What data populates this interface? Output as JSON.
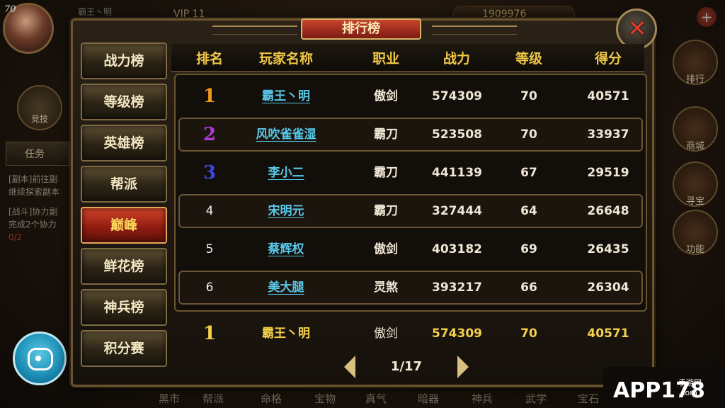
{
  "hud": {
    "level": "70",
    "player_name": "霸王丶明",
    "vip": "VIP 11",
    "gold": "1909976",
    "plus": "+",
    "task_label": "任务",
    "quest_line_1": "[副本]前往副",
    "quest_line_2": "继续探索副本",
    "quest_line_3": "[战斗]协力副",
    "quest_line_4": "完成2个协力",
    "quest_line_5": "0/2",
    "arena_label": "竞技",
    "right_icons": [
      "排行",
      "商城",
      "寻宝",
      "功能"
    ],
    "bottom_bar": [
      "黑市",
      "帮派",
      "命格",
      "宝物",
      "真气",
      "暗器",
      "神兵",
      "武学",
      "宝石"
    ]
  },
  "panel": {
    "title": "排行榜",
    "close_symbol": "✕"
  },
  "tabs": [
    {
      "label": "战力榜",
      "active": false
    },
    {
      "label": "等级榜",
      "active": false
    },
    {
      "label": "英雄榜",
      "active": false
    },
    {
      "label": "帮派",
      "active": false
    },
    {
      "label": "巅峰",
      "active": true
    },
    {
      "label": "鲜花榜",
      "active": false
    },
    {
      "label": "神兵榜",
      "active": false
    },
    {
      "label": "积分赛",
      "active": false
    }
  ],
  "table": {
    "headers": {
      "rank": "排名",
      "name": "玩家名称",
      "job": "职业",
      "power": "战力",
      "level": "等级",
      "score": "得分"
    },
    "rows": [
      {
        "rank": "1",
        "name": "霸王丶明",
        "job": "傲剑",
        "power": "574309",
        "level": "70",
        "score": "40571"
      },
      {
        "rank": "2",
        "name": "风吹雀雀湿",
        "job": "霸刀",
        "power": "523508",
        "level": "70",
        "score": "33937"
      },
      {
        "rank": "3",
        "name": "李小二",
        "job": "霸刀",
        "power": "441139",
        "level": "67",
        "score": "29519"
      },
      {
        "rank": "4",
        "name": "宋明元",
        "job": "霸刀",
        "power": "327444",
        "level": "64",
        "score": "26648"
      },
      {
        "rank": "5",
        "name": "蔡辉权",
        "job": "傲剑",
        "power": "403182",
        "level": "69",
        "score": "26435"
      },
      {
        "rank": "6",
        "name": "美大腿",
        "job": "灵煞",
        "power": "393217",
        "level": "66",
        "score": "26304"
      }
    ],
    "my_row": {
      "rank": "1",
      "name": "霸王丶明",
      "job": "傲剑",
      "power": "574309",
      "level": "70",
      "score": "40571"
    }
  },
  "pager": {
    "page": "1/17"
  },
  "watermark": {
    "brand": "APP178",
    "sub1": "手游网",
    "sub2": ".com"
  }
}
